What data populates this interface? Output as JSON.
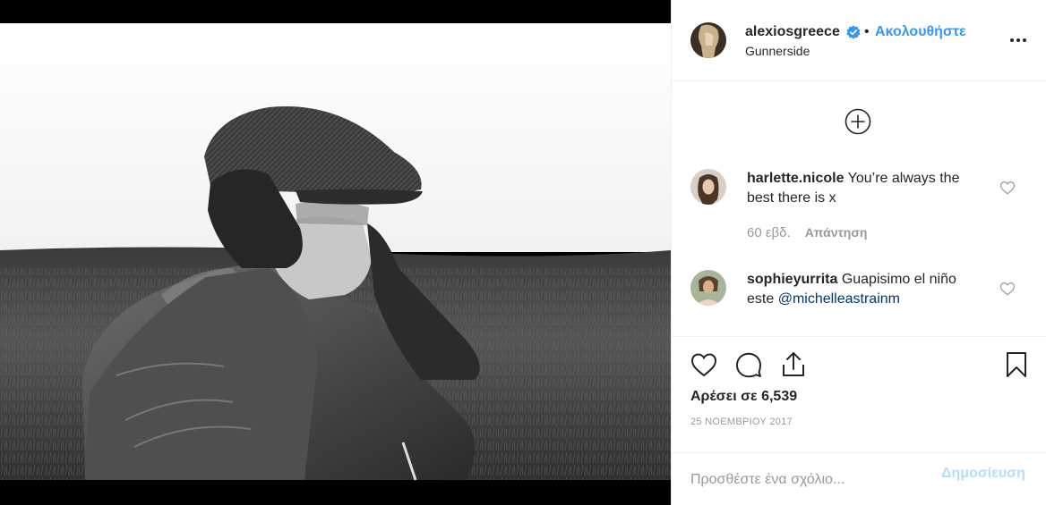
{
  "post": {
    "image_alt_icon": "photo-man-in-flat-cap-icon",
    "author": {
      "username": "alexiosgreece",
      "verified_icon": "verified-badge-icon",
      "separator": "•",
      "follow_label": "Ακολουθήστε",
      "location": "Gunnerside"
    },
    "more_icon": "more-options-icon",
    "load_more_icon": "load-more-comments-icon",
    "comments": [
      {
        "username": "harlette.nicole",
        "text": "You’re always the best there is x",
        "mention": "",
        "age": "60 εβδ.",
        "reply_label": "Απάντηση",
        "like_icon": "heart-outline-icon"
      },
      {
        "username": "sophieyurrita",
        "text": "Guapisimo el niño este",
        "mention": "@michelleastrainm",
        "age": "",
        "reply_label": "",
        "like_icon": "heart-outline-icon"
      }
    ],
    "actions": {
      "like_icon": "heart-outline-icon",
      "comment_icon": "comment-bubble-icon",
      "share_icon": "share-upload-icon",
      "save_icon": "bookmark-icon"
    },
    "likes_text": "Αρέσει σε 6,539",
    "date": "25 ΝΟΕΜΒΡΙΟΥ 2017",
    "compose": {
      "placeholder": "Προσθέστε ένα σχόλιο...",
      "post_label": "Δημοσίευση"
    }
  },
  "colors": {
    "link_blue": "#3897f0",
    "post_disabled": "#b2dffc",
    "muted": "#999999",
    "mention": "#003569"
  }
}
